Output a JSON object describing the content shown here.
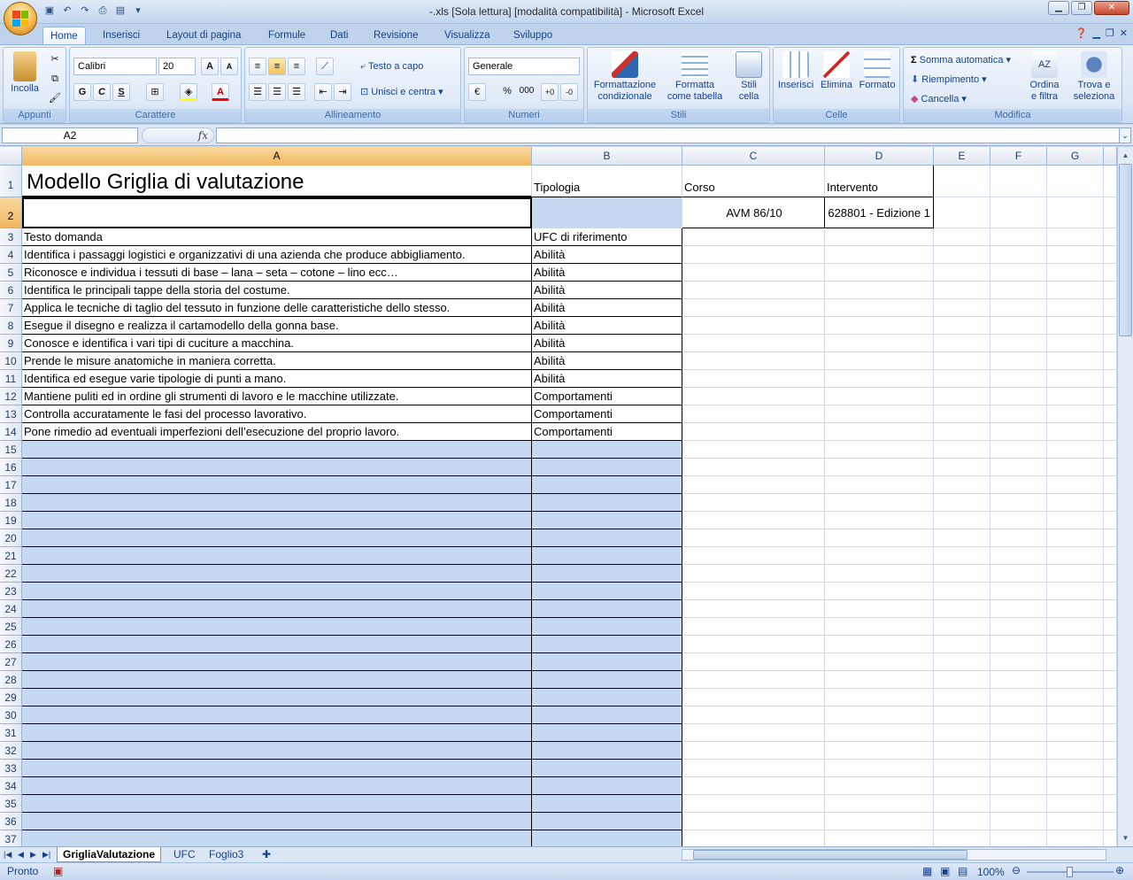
{
  "window": {
    "title": "-.xls  [Sola lettura]  [modalità compatibilità] - Microsoft Excel"
  },
  "tabs": [
    "Home",
    "Inserisci",
    "Layout di pagina",
    "Formule",
    "Dati",
    "Revisione",
    "Visualizza",
    "Sviluppo"
  ],
  "ribbon": {
    "appunti": {
      "label": "Appunti",
      "paste": "Incolla"
    },
    "carattere": {
      "label": "Carattere",
      "font": "Calibri",
      "size": "20",
      "bold": "G",
      "italic": "C",
      "underline": "S"
    },
    "allineamento": {
      "label": "Allineamento",
      "wrap": "Testo a capo",
      "merge": "Unisci e centra"
    },
    "numeri": {
      "label": "Numeri",
      "format": "Generale",
      "percent": "%",
      "thousands": "000"
    },
    "stili": {
      "label": "Stili",
      "cond1": "Formattazione",
      "cond2": "condizionale",
      "table1": "Formatta",
      "table2": "come tabella",
      "cell1": "Stili",
      "cell2": "cella"
    },
    "celle": {
      "label": "Celle",
      "insert": "Inserisci",
      "delete": "Elimina",
      "format": "Formato"
    },
    "modifica": {
      "label": "Modifica",
      "autosum": "Somma automatica",
      "fill": "Riempimento",
      "clear": "Cancella",
      "sort1": "Ordina",
      "sort2": "e filtra",
      "find1": "Trova e",
      "find2": "seleziona"
    }
  },
  "formula_bar": {
    "name_box": "A2",
    "fx": "fx",
    "content": ""
  },
  "columns": [
    "A",
    "B",
    "C",
    "D",
    "E",
    "F",
    "G"
  ],
  "cells": {
    "A1": "Modello Griglia di valutazione",
    "B1": "Tipologia",
    "C1": "Corso",
    "D1": "Intervento",
    "C2": "AVM 86/10",
    "D2": "628801 - Edizione 1",
    "A3": "Testo domanda",
    "B3": "UFC di riferimento"
  },
  "rows": [
    {
      "text": "Identifica i passaggi logistici e organizzativi di una azienda che produce abbigliamento.",
      "type": "Abilità"
    },
    {
      "text": "Riconosce e individua i tessuti di base – lana – seta – cotone – lino ecc…",
      "type": "Abilità"
    },
    {
      "text": "Identifica le principali tappe della storia del costume.",
      "type": "Abilità"
    },
    {
      "text": "Applica le tecniche di taglio del tessuto in funzione delle caratteristiche dello stesso.",
      "type": "Abilità"
    },
    {
      "text": "Esegue il disegno e realizza il cartamodello della gonna base.",
      "type": "Abilità"
    },
    {
      "text": "Conosce e identifica i vari tipi di cuciture a macchina.",
      "type": "Abilità"
    },
    {
      "text": "Prende le misure anatomiche in maniera corretta.",
      "type": "Abilità"
    },
    {
      "text": "Identifica ed esegue varie tipologie di punti a mano.",
      "type": "Abilità"
    },
    {
      "text": "Mantiene puliti ed in ordine gli strumenti di lavoro e le macchine utilizzate.",
      "type": "Comportamenti"
    },
    {
      "text": "Controlla accuratamente le fasi del processo lavorativo.",
      "type": "Comportamenti"
    },
    {
      "text": "Pone rimedio ad eventuali imperfezioni dell’esecuzione del proprio lavoro.",
      "type": "Comportamenti"
    }
  ],
  "sheet_tabs": [
    "GrigliaValutazione",
    "UFC",
    "Foglio3"
  ],
  "status": {
    "ready": "Pronto",
    "zoom": "100%"
  }
}
